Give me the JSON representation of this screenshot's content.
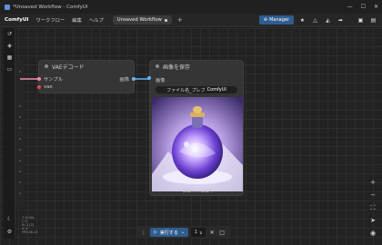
{
  "window": {
    "title": "*Unsaved Workflow - ComfyUI",
    "controls": [
      "—",
      "☐",
      "✕"
    ]
  },
  "menubar": {
    "brand": "ComfyUI",
    "items": [
      "ワークフロー",
      "編集",
      "ヘルプ"
    ],
    "tab_label": "Unsaved Workflow",
    "new_tab": "+",
    "manager_label": "Manager"
  },
  "nodes": {
    "vae_decode": {
      "title": "VAEデコード",
      "inputs": [
        {
          "label": "サンプル",
          "color": "#f28ab8"
        },
        {
          "label": "vae",
          "color": "#e5484d"
        }
      ],
      "output": {
        "label": "画像",
        "color": "#64b5f6"
      }
    },
    "save_image": {
      "title": "画像を保存",
      "input": {
        "label": "画像",
        "color": "#64b5f6"
      },
      "filename_label": "ファイル名_プレフ",
      "filename_value": "ComfyUI",
      "image_caption": "1024 × 1024"
    }
  },
  "runbar": {
    "run_label": "実行する",
    "count": "1"
  },
  "stats": [
    "T: 0.00s",
    "I: 0",
    "N: 2 [2]",
    "V: 4",
    "FPS:46.15"
  ],
  "colors": {
    "accent": "#2f5d8f",
    "node_bg": "#353535",
    "canvas_bg": "#222222"
  }
}
